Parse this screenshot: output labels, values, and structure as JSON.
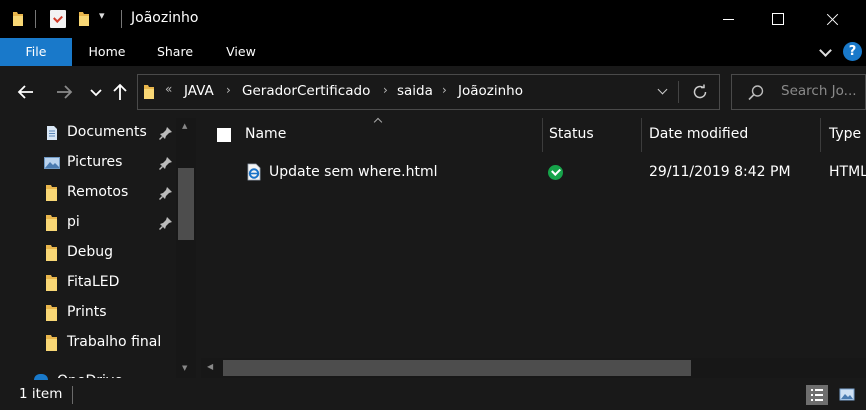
{
  "window": {
    "title": "Joãozinho",
    "quick_access_dropdown": "▾"
  },
  "ribbon": {
    "tabs": [
      {
        "label": "File",
        "active": true
      },
      {
        "label": "Home"
      },
      {
        "label": "Share"
      },
      {
        "label": "View"
      }
    ],
    "help": "?"
  },
  "navigation": {
    "breadcrumb_overflow": "«",
    "breadcrumb": [
      "JAVA",
      "GeradorCertificado",
      "saida",
      "Joãozinho"
    ],
    "search_placeholder": "Search Jo..."
  },
  "sidebar": {
    "items": [
      {
        "label": "Documents",
        "icon": "documents-icon",
        "pinned": true
      },
      {
        "label": "Pictures",
        "icon": "pictures-icon",
        "pinned": true
      },
      {
        "label": "Remotos",
        "icon": "folder-icon",
        "pinned": true
      },
      {
        "label": "pi",
        "icon": "folder-icon",
        "pinned": true
      },
      {
        "label": "Debug",
        "icon": "folder-icon"
      },
      {
        "label": "FitaLED",
        "icon": "folder-icon"
      },
      {
        "label": "Prints",
        "icon": "folder-icon"
      },
      {
        "label": "Trabalho final",
        "icon": "folder-icon"
      }
    ],
    "partial_item": "OneDrive"
  },
  "file_list": {
    "columns": [
      "Name",
      "Status",
      "Date modified",
      "Type"
    ],
    "rows": [
      {
        "name": "Update sem where.html",
        "status": "synced",
        "date_modified": "29/11/2019 8:42 PM",
        "type": "HTML"
      }
    ]
  },
  "status_bar": {
    "item_count": "1 item"
  },
  "colors": {
    "accent": "#1979ca",
    "background": "#191919",
    "titlebar": "#000000",
    "folder": "#f8d775",
    "status_ok": "#16a34a"
  }
}
